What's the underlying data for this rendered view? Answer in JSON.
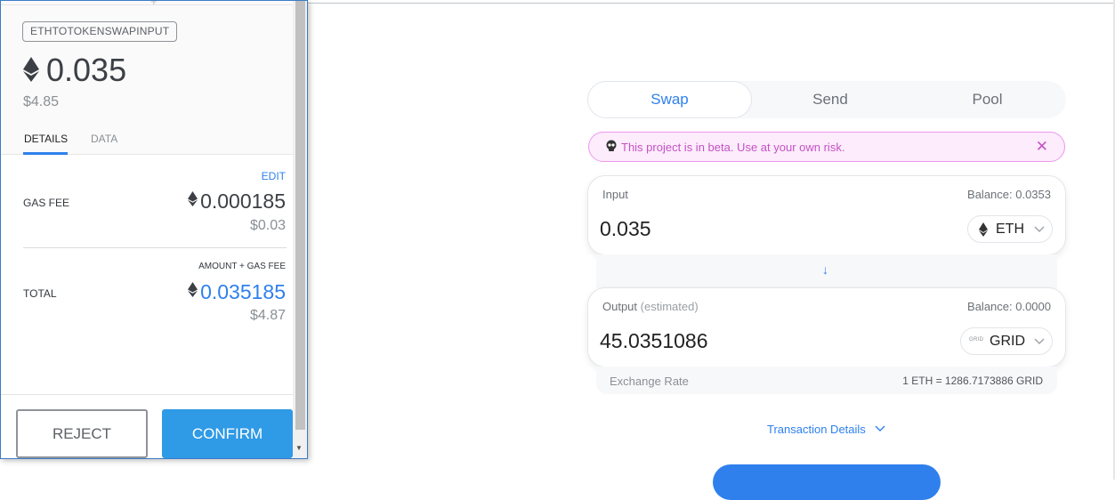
{
  "popup": {
    "method": "ETHTOTOKENSWAPINPUT",
    "amount": "0.035",
    "amount_usd": "$4.85",
    "tabs": [
      "DETAILS",
      "DATA"
    ],
    "edit_label": "EDIT",
    "gas_fee_label": "GAS FEE",
    "gas_fee": "0.000185",
    "gas_fee_usd": "$0.03",
    "amount_gas_label": "AMOUNT + GAS FEE",
    "total_label": "TOTAL",
    "total": "0.035185",
    "total_usd": "$4.87",
    "reject_label": "REJECT",
    "confirm_label": "CONFIRM"
  },
  "swap": {
    "tabs": [
      "Swap",
      "Send",
      "Pool"
    ],
    "beta_notice": "This project is in beta. Use at your own risk.",
    "input": {
      "label": "Input",
      "balance": "Balance: 0.0353",
      "amount": "0.035",
      "token": "ETH"
    },
    "output": {
      "label": "Output",
      "label_note": "(estimated)",
      "balance": "Balance: 0.0000",
      "amount": "45.0351086",
      "token": "GRID",
      "token_logo_text": "GRID"
    },
    "exchange_rate_label": "Exchange Rate",
    "exchange_rate": "1 ETH = 1286.7173886 GRID",
    "transaction_details": "Transaction Details"
  },
  "colors": {
    "accent": "#2f80ed",
    "confirm": "#2f9ae6",
    "beta_bg": "#fcecfc",
    "beta_border": "#ee97ee",
    "beta_text": "#c452c4"
  }
}
